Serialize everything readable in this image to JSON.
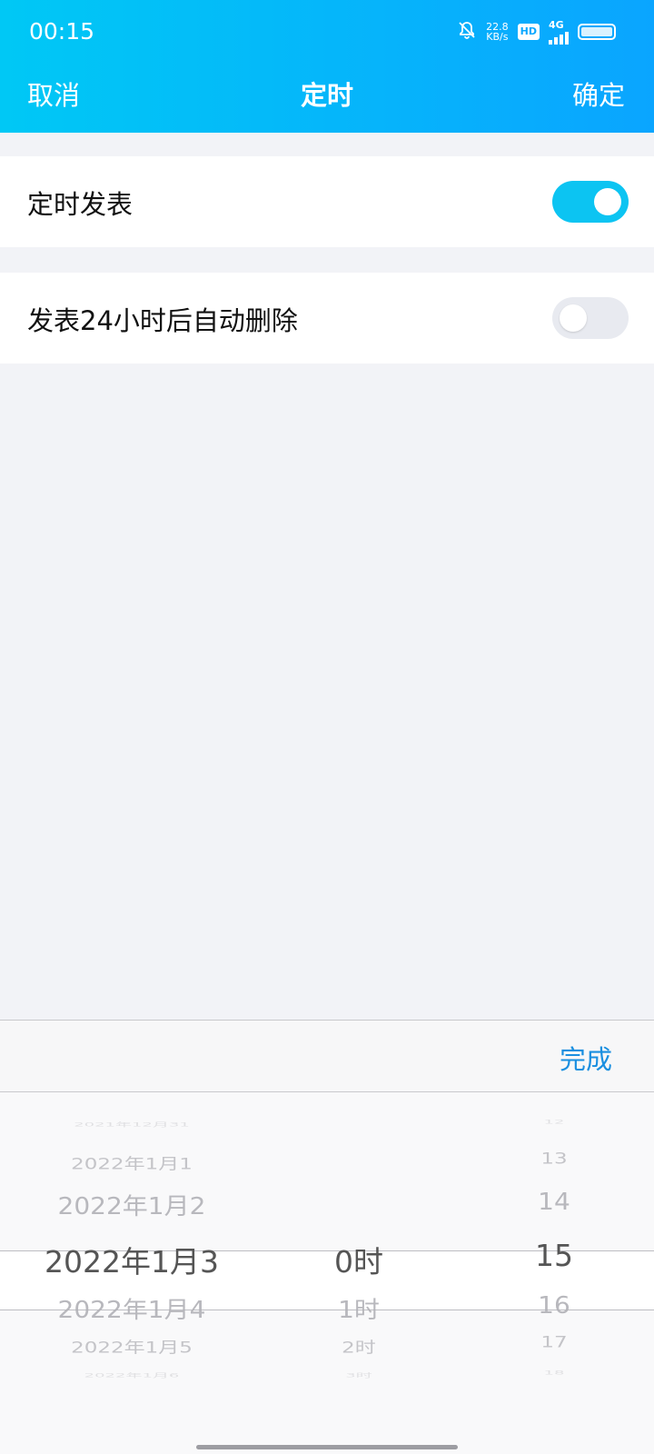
{
  "status_bar": {
    "time": "00:15",
    "speed_value": "22.8",
    "speed_unit": "KB/s",
    "hd_label": "HD",
    "network_label": "4G",
    "icons": [
      "mute-bell-icon",
      "hd-icon",
      "signal-icon",
      "battery-icon"
    ]
  },
  "nav": {
    "cancel_label": "取消",
    "title": "定时",
    "confirm_label": "确定"
  },
  "settings": {
    "scheduled_publish": {
      "label": "定时发表",
      "enabled": true
    },
    "auto_delete": {
      "label": "发表24小时后自动删除",
      "enabled": false
    }
  },
  "picker": {
    "done_label": "完成",
    "dates": [
      "2021年12月31",
      "2022年1月1",
      "2022年1月2",
      "2022年1月3",
      "2022年1月4",
      "2022年1月5",
      "2022年1月6"
    ],
    "hours": [
      "0时",
      "1时",
      "2时",
      "3时"
    ],
    "minutes": [
      "12",
      "13",
      "14",
      "15",
      "16",
      "17",
      "18"
    ],
    "selected": {
      "date": "2022年1月3",
      "hour": "0时",
      "minute": "15"
    }
  },
  "colors": {
    "header_gradient_start": "#00c8f5",
    "header_gradient_end": "#0aa5ff",
    "toggle_on": "#0cc4f2",
    "toggle_off": "#e8eaf0",
    "done_accent": "#1a8fe0"
  }
}
